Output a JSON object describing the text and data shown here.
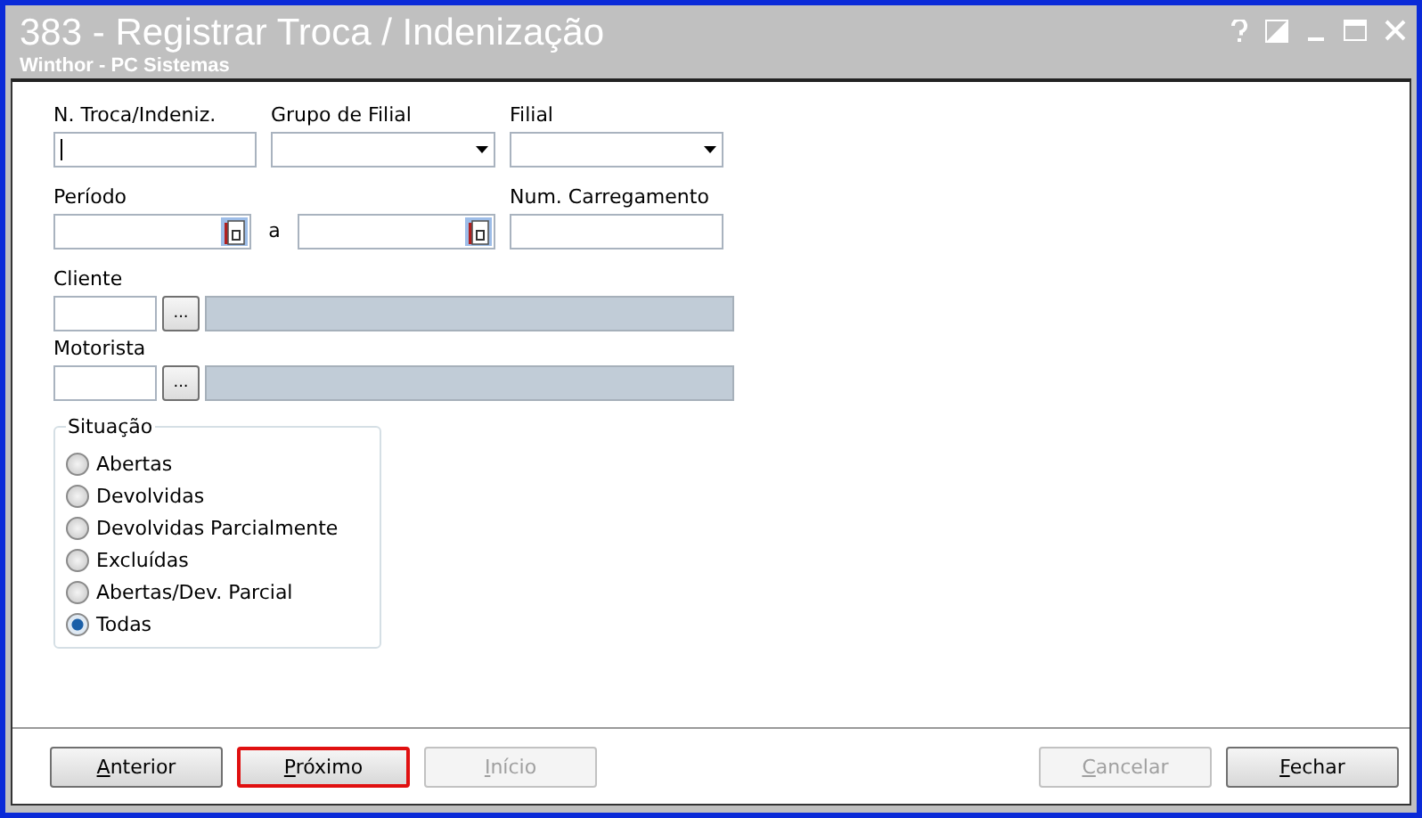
{
  "window": {
    "title": "383 - Registrar Troca / Indenização",
    "subtitle": "Winthor - PC Sistemas"
  },
  "fields": {
    "troca": {
      "label": "N. Troca/Indeniz.",
      "focused": true
    },
    "grupo_filial": {
      "label": "Grupo de Filial"
    },
    "filial": {
      "label": "Filial"
    },
    "periodo": {
      "label": "Período",
      "separator": "a"
    },
    "carregamento": {
      "label": "Num. Carregamento"
    },
    "cliente": {
      "label": "Cliente",
      "button": "..."
    },
    "motorista": {
      "label": "Motorista",
      "button": "..."
    }
  },
  "situacao": {
    "title": "Situação",
    "options": [
      {
        "label": "Abertas",
        "selected": false
      },
      {
        "label": "Devolvidas",
        "selected": false
      },
      {
        "label": "Devolvidas Parcialmente",
        "selected": false
      },
      {
        "label": "Excluídas",
        "selected": false
      },
      {
        "label": "Abertas/Dev. Parcial",
        "selected": false
      },
      {
        "label": "Todas",
        "selected": true
      }
    ]
  },
  "buttons_left": [
    {
      "label": "Anterior",
      "disabled": false,
      "highlighted": false
    },
    {
      "label": "Próximo",
      "disabled": false,
      "highlighted": true
    },
    {
      "label": "Início",
      "disabled": true,
      "highlighted": false
    }
  ],
  "buttons_right": [
    {
      "label": "Cancelar",
      "disabled": true,
      "highlighted": false
    },
    {
      "label": "Fechar",
      "disabled": false,
      "highlighted": false
    }
  ]
}
